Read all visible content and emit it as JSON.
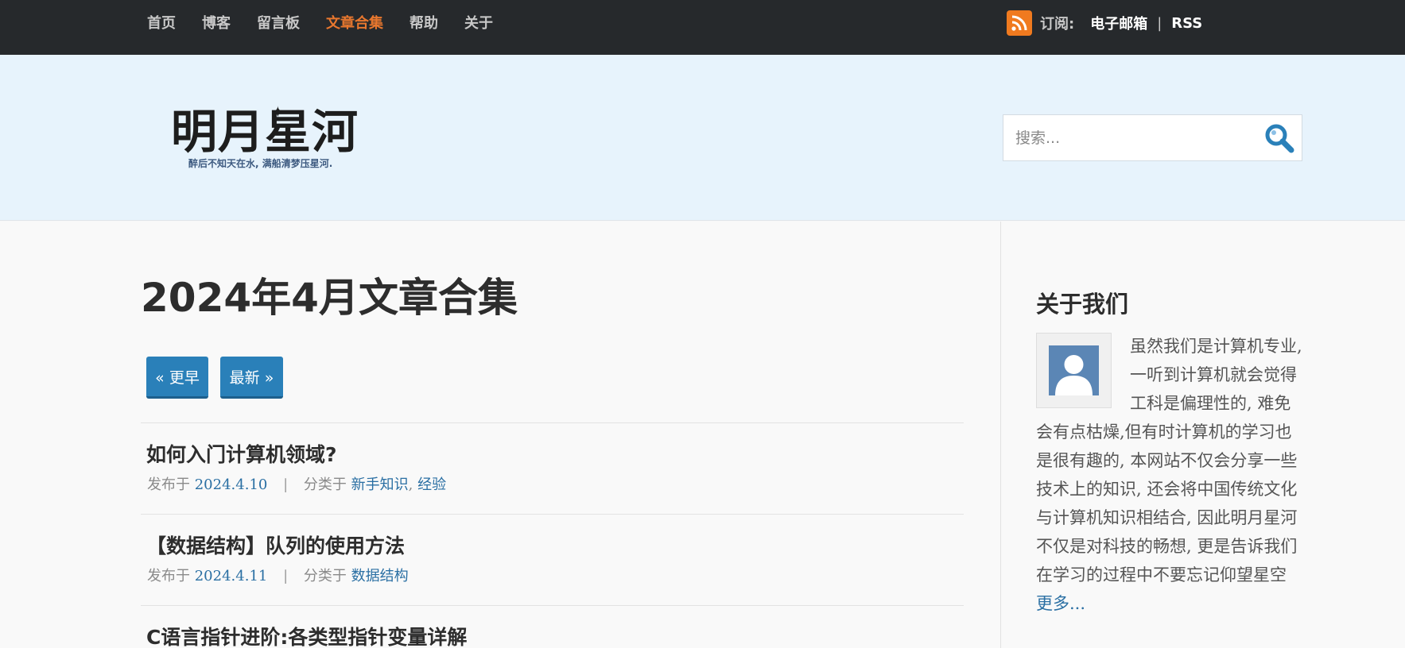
{
  "nav": {
    "items": [
      {
        "label": "首页",
        "active": false
      },
      {
        "label": "博客",
        "active": false
      },
      {
        "label": "留言板",
        "active": false
      },
      {
        "label": "文章合集",
        "active": true
      },
      {
        "label": "帮助",
        "active": false
      },
      {
        "label": "关于",
        "active": false
      }
    ],
    "subscribe_label": "订阅:",
    "email_label": "电子邮箱",
    "separator": "|",
    "rss_label": "RSS",
    "rss_icon": "rss-icon"
  },
  "header": {
    "logo_title": "明月星河",
    "logo_tagline": "醉后不知天在水, 满船清梦压星河.",
    "search_placeholder": "搜索...",
    "search_icon": "search-icon"
  },
  "main": {
    "page_title": "2024年4月文章合集",
    "older_button": "« 更早",
    "newer_button": "最新 »",
    "posts": [
      {
        "title": "如何入门计算机领域?",
        "published_label": "发布于",
        "date": "2024.4.10",
        "category_label": "分类于",
        "categories": [
          "新手知识",
          "经验"
        ],
        "meta_sep": "|"
      },
      {
        "title": "【数据结构】队列的使用方法",
        "published_label": "发布于",
        "date": "2024.4.11",
        "category_label": "分类于",
        "categories": [
          "数据结构"
        ],
        "meta_sep": "|"
      },
      {
        "title": "C语言指针进阶:各类型指针变量详解"
      }
    ]
  },
  "sidebar": {
    "about_title": "关于我们",
    "about_text": "虽然我们是计算机专业, 一听到计算机就会觉得工科是偏理性的, 难免会有点枯燥,但有时计算机的学习也是很有趣的, 本网站不仅会分享一些技术上的知识, 还会将中国传统文化与计算机知识相结合, 因此明月星河不仅是对科技的畅想, 更是告诉我们在学习的过程中不要忘记仰望星空",
    "more_link": "更多..."
  },
  "colors": {
    "topbar": "#26292c",
    "nav_active": "#e8772e",
    "header_bg": "#e7f3fc",
    "button_blue": "#2a80b9",
    "link_blue": "#2a6fa3"
  }
}
